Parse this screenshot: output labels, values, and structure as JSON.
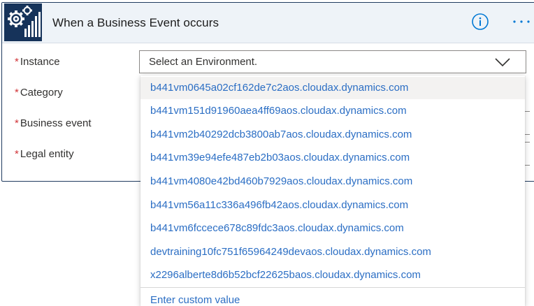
{
  "header": {
    "title": "When a Business Event occurs",
    "app_icon": "business-events-gear-icon",
    "info_icon": "info-icon",
    "more_icon": "ellipsis-icon"
  },
  "fields": [
    {
      "label": "Instance",
      "required": true
    },
    {
      "label": "Category",
      "required": true
    },
    {
      "label": "Business event",
      "required": true
    },
    {
      "label": "Legal entity",
      "required": true
    }
  ],
  "required_marker": "*",
  "instance_select": {
    "placeholder": "Select an Environment.",
    "icon": "chevron-down-icon"
  },
  "dropdown": {
    "options": [
      "b441vm0645a02cf162de7c2aos.cloudax.dynamics.com",
      "b441vm151d91960aea4ff69aos.cloudax.dynamics.com",
      "b441vm2b40292dcb3800ab7aos.cloudax.dynamics.com",
      "b441vm39e94efe487eb2b03aos.cloudax.dynamics.com",
      "b441vm4080e42bd460b7929aos.cloudax.dynamics.com",
      "b441vm56a11c336a496fb42aos.cloudax.dynamics.com",
      "b441vm6fccece678c89fdc3aos.cloudax.dynamics.com",
      "devtraining10fc751f65964249devaos.cloudax.dynamics.com",
      "x2296alberte8d6b52bcf22625baos.cloudax.dynamics.com"
    ],
    "custom_value_label": "Enter custom value"
  },
  "colors": {
    "header_bg": "#eef3f8",
    "icon_bg": "#16335a",
    "link": "#2b6ec4",
    "required": "#d13438",
    "accent": "#0078d4"
  }
}
